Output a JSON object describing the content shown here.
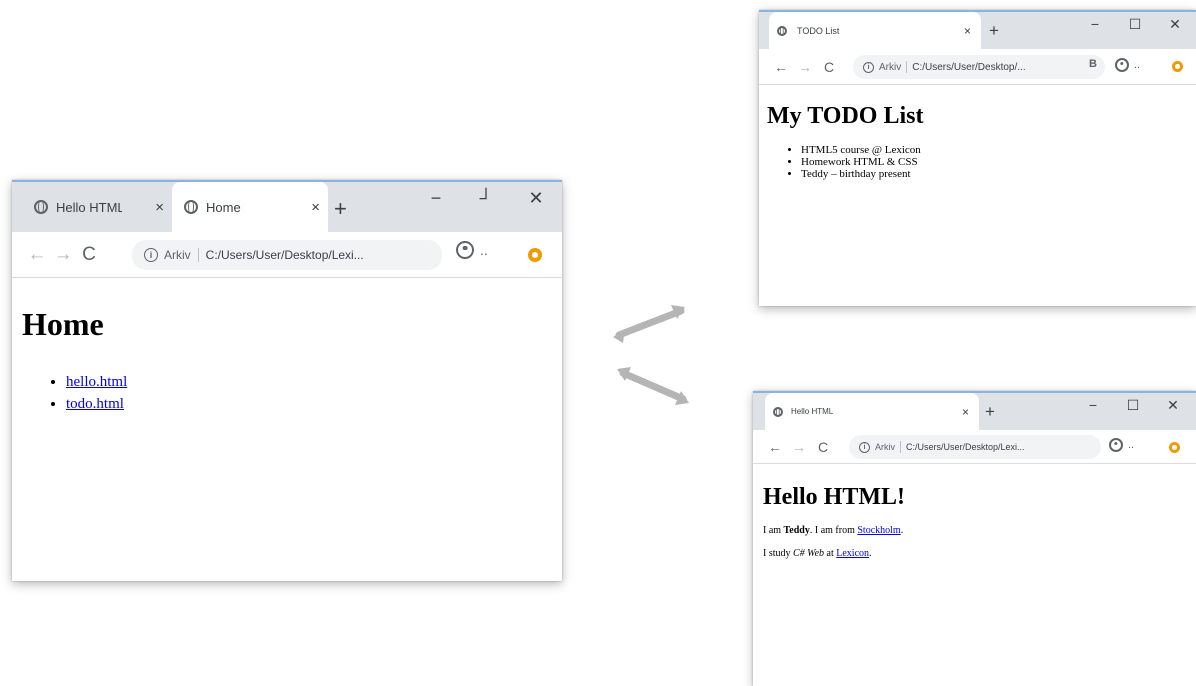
{
  "windows": {
    "home": {
      "tabs": [
        {
          "label": "Hello HTML",
          "close": "×"
        },
        {
          "label": "Home",
          "close": "×"
        }
      ],
      "new_tab": "+",
      "controls": {
        "minimize": "−",
        "maximize": "┘",
        "close": "✕"
      },
      "nav": {
        "back": "←",
        "forward": "→",
        "reload": "C"
      },
      "address": {
        "info": "i",
        "prefix": "Arkiv",
        "url": "C:/Users/User/Desktop/Lexi..."
      },
      "profile_menu": "..",
      "page": {
        "heading": "Home",
        "links": [
          "hello.html",
          "todo.html"
        ]
      }
    },
    "todo": {
      "tabs": [
        {
          "label": "TODO List",
          "close": "×"
        }
      ],
      "new_tab": "+",
      "controls": {
        "minimize": "−",
        "maximize": "☐",
        "close": "✕"
      },
      "nav": {
        "back": "←",
        "forward": "→",
        "reload": "C"
      },
      "address": {
        "info": "i",
        "prefix": "Arkiv",
        "url": "C:/Users/User/Desktop/..."
      },
      "reader": "B",
      "profile_menu": "..",
      "page": {
        "heading": "My TODO List",
        "items": [
          "HTML5 course @ Lexicon",
          "Homework HTML & CSS",
          "Teddy – birthday present"
        ]
      }
    },
    "hello": {
      "tabs": [
        {
          "label": "Hello HTML",
          "close": "×"
        }
      ],
      "new_tab": "+",
      "controls": {
        "minimize": "−",
        "maximize": "☐",
        "close": "✕"
      },
      "nav": {
        "back": "←",
        "forward": "→",
        "reload": "C"
      },
      "address": {
        "info": "i",
        "prefix": "Arkiv",
        "url": "C:/Users/User/Desktop/Lexi..."
      },
      "profile_menu": "..",
      "page": {
        "heading": "Hello HTML!",
        "p1": {
          "pre": "I am ",
          "bold": "Teddy",
          "mid": ". I am from ",
          "link": "Stockholm",
          "post": "."
        },
        "p2": {
          "pre": "I study ",
          "italic": "C# Web",
          "mid": " at ",
          "link": "Lexicon",
          "post": "."
        }
      }
    }
  },
  "colors": {
    "tabstrip": "#dee1e6",
    "accent_border": "#8ab4e0",
    "link": "#0000ee",
    "extension": "#f29900",
    "arrow": "#b5b5b5"
  },
  "icons": [
    "globe-icon",
    "close-icon",
    "plus-icon",
    "back-arrow-icon",
    "forward-arrow-icon",
    "reload-icon",
    "info-icon",
    "profile-icon",
    "extension-icon",
    "double-arrow-icon"
  ]
}
